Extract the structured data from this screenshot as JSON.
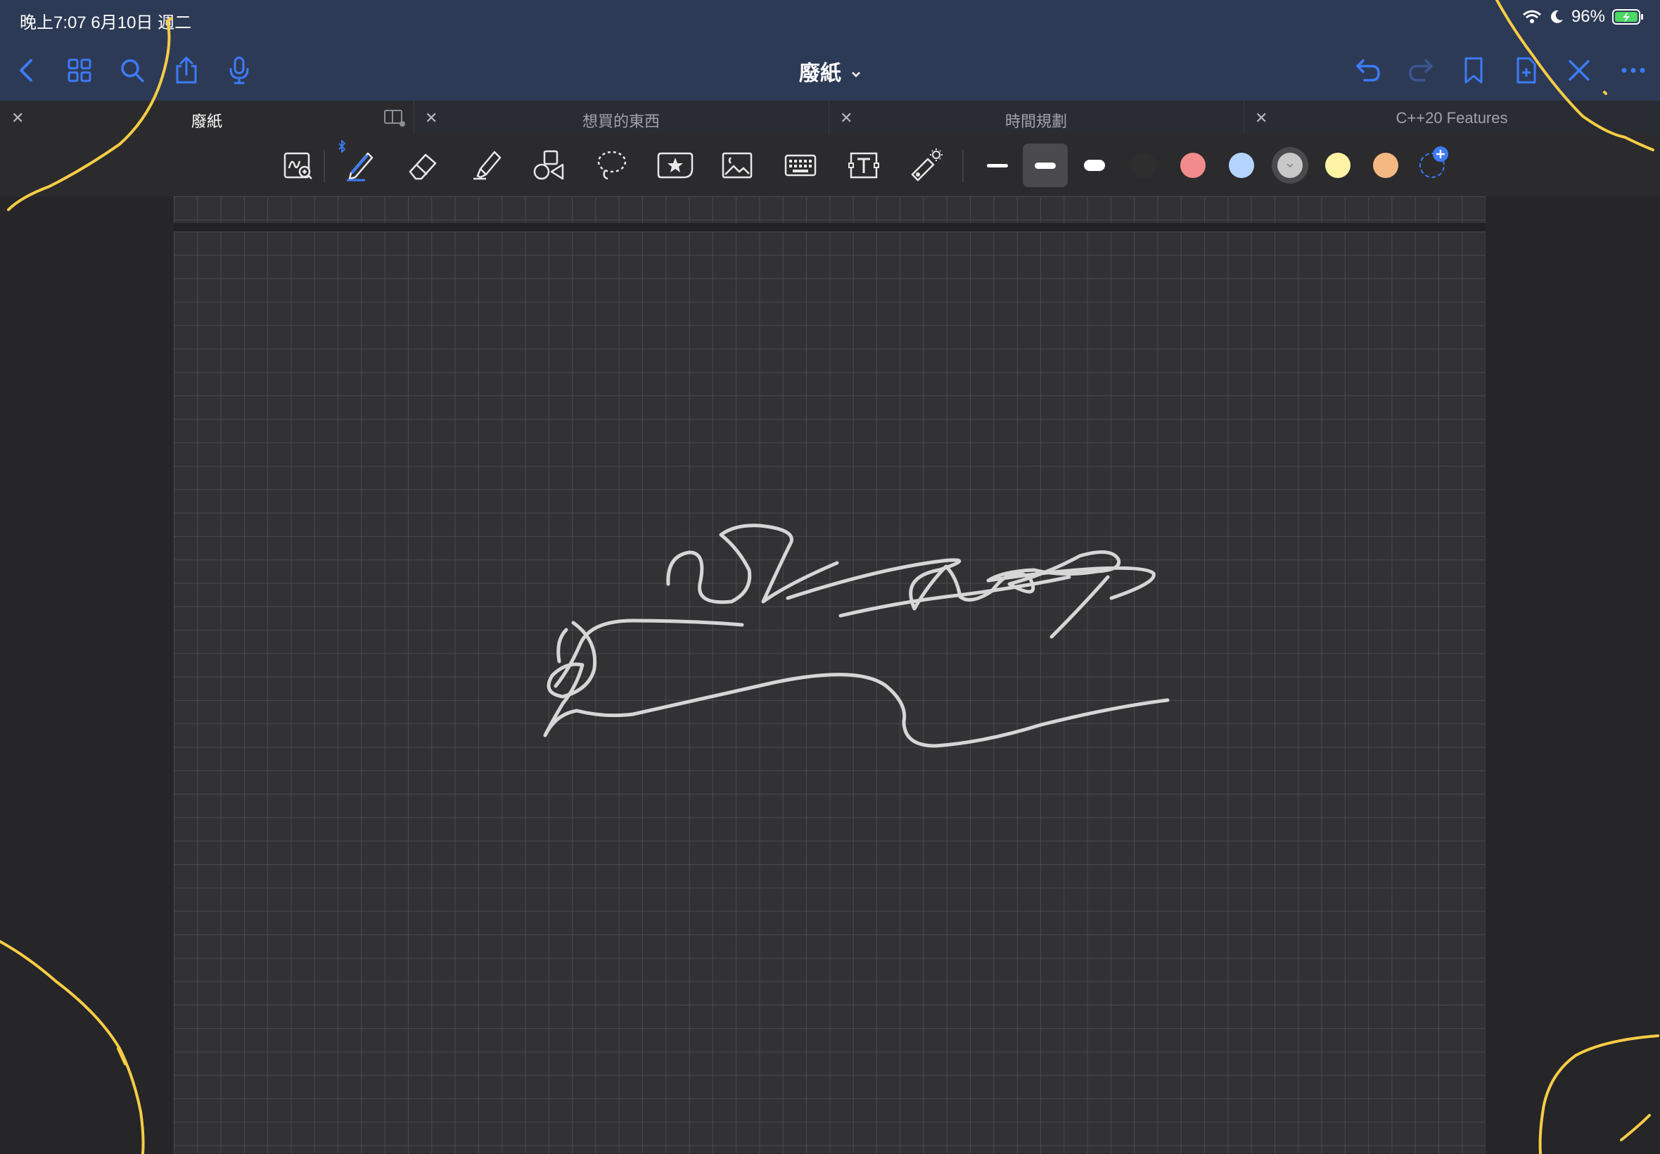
{
  "status": {
    "time_date": "晚上7:07   6月10日 週二",
    "battery": "96%"
  },
  "nav": {
    "title": "廢紙"
  },
  "tabs": [
    {
      "label": "廢紙",
      "active": true
    },
    {
      "label": "想買的東西",
      "active": false
    },
    {
      "label": "時間規劃",
      "active": false
    },
    {
      "label": "C++20 Features",
      "active": false
    }
  ],
  "toolbar": {
    "tools": [
      "zoom-window-icon",
      "pen-icon",
      "eraser-icon",
      "highlighter-icon",
      "shapes-icon",
      "lasso-icon",
      "sticker-icon",
      "image-icon",
      "keyboard-icon",
      "text-box-icon",
      "laser-pointer-icon"
    ],
    "stroke_widths": [
      "thin",
      "medium",
      "thick"
    ],
    "selected_width": "medium",
    "colors": [
      "#2e2e2e",
      "#f28b8b",
      "#b4d4ff",
      "#c8c8c8",
      "#fff3a6",
      "#f4b882"
    ],
    "selected_color": "#c8c8c8"
  },
  "accent_color": "#3d7bf7",
  "annotation_color": "#f7cd46"
}
